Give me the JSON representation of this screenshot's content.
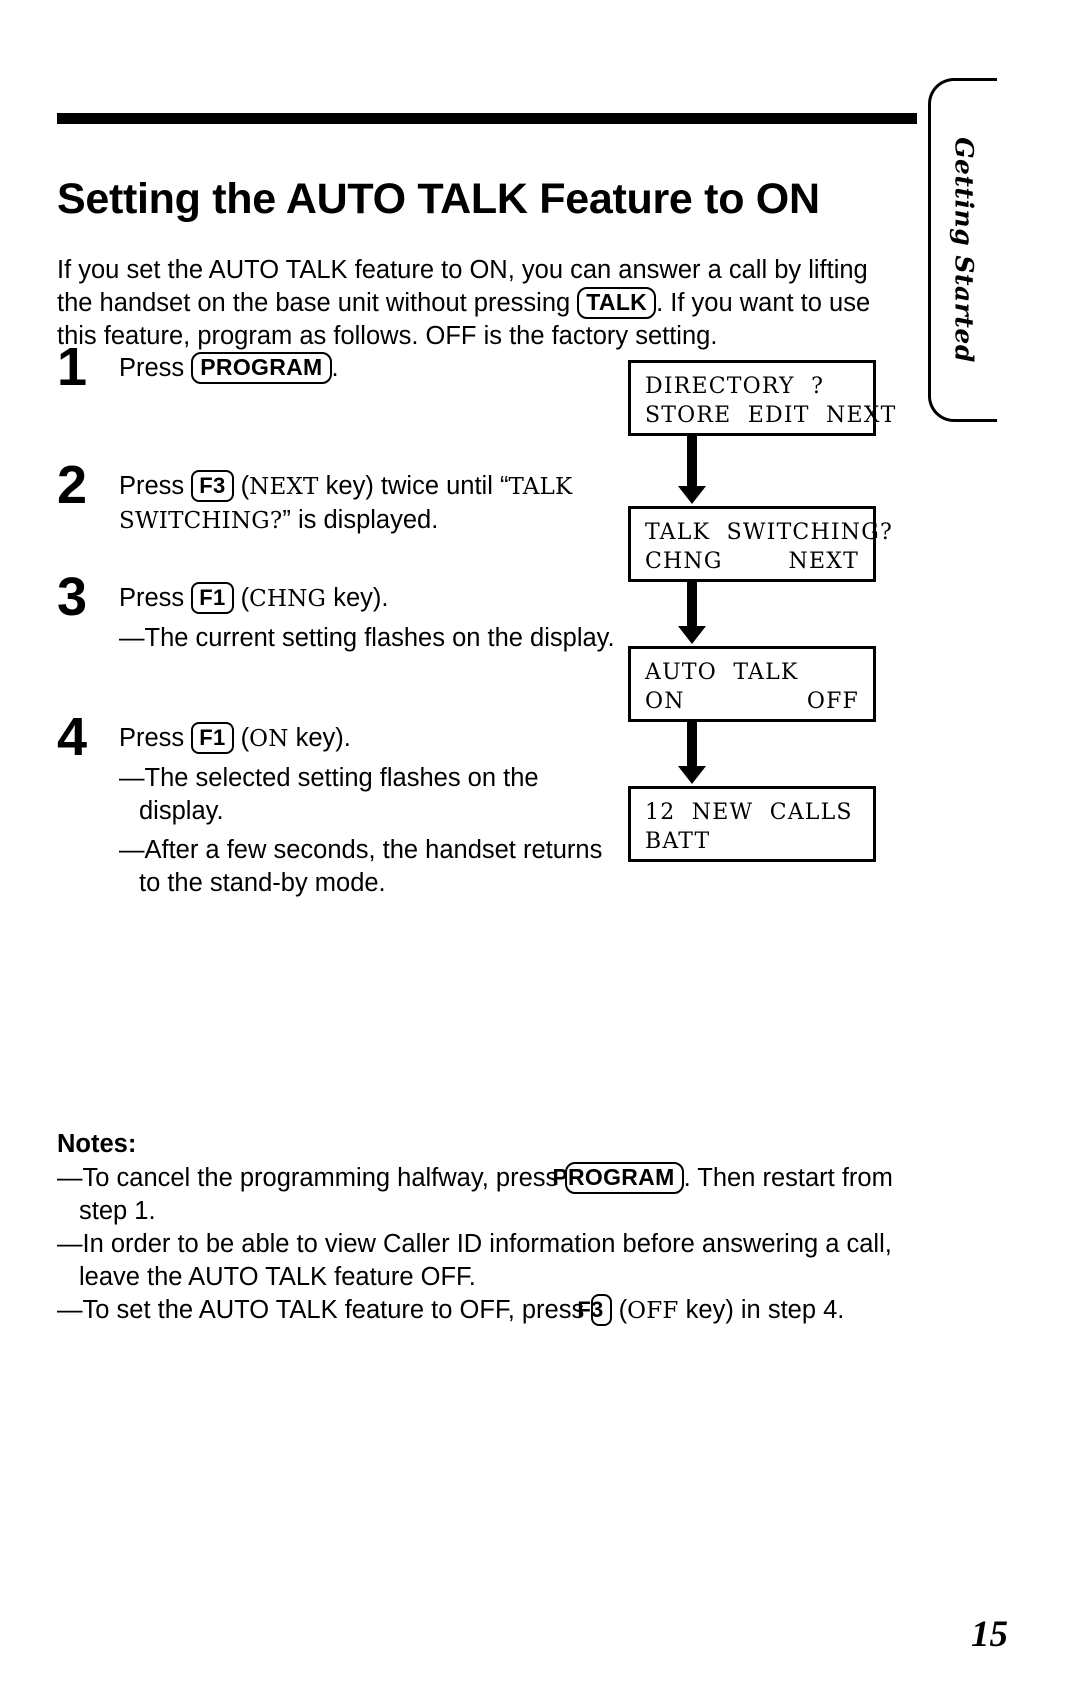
{
  "side_tab": {
    "label": "Getting Started"
  },
  "title": "Setting the AUTO TALK Feature to ON",
  "intro": {
    "part1": "If you set the AUTO TALK feature to ON, you can answer a call by lifting the handset on the base unit without pressing ",
    "key_talk": "TALK",
    "part2": ". If you want to use this feature, program as follows. OFF is the factory setting."
  },
  "steps": [
    {
      "number": "1",
      "pre": "Press ",
      "key": "PROGRAM",
      "post": ".",
      "bullets": []
    },
    {
      "number": "2",
      "pre": "Press ",
      "key": "F3",
      "mid": " (",
      "key_name": "NEXT",
      "post": " key) twice until “",
      "display_ref": "TALK SWITCHING?",
      "tail": "” is displayed.",
      "bullets": []
    },
    {
      "number": "3",
      "pre": "Press ",
      "key": "F1",
      "mid": " (",
      "key_name": "CHNG",
      "post": " key).",
      "bullets": [
        "—The current setting flashes on the display."
      ]
    },
    {
      "number": "4",
      "pre": "Press ",
      "key": "F1",
      "mid": " (",
      "key_name": "ON",
      "post": " key).",
      "bullets": [
        "—The selected setting flashes on the display.",
        "—After a few seconds, the handset returns to the stand-by mode."
      ]
    }
  ],
  "flow": {
    "screens": [
      {
        "line1_left": "DIRECTORY  ?",
        "line1_right": "",
        "line2_left": "STORE  EDIT  NEXT",
        "line2_right": ""
      },
      {
        "line1_left": "TALK  SWITCHING?",
        "line1_right": "",
        "line2_left": "CHNG",
        "line2_right": "NEXT"
      },
      {
        "line1_left": "AUTO  TALK",
        "line1_right": "",
        "line2_left": "ON",
        "line2_right": "OFF"
      },
      {
        "line1_left": "12  NEW  CALLS",
        "line1_right": "",
        "line2_left": "BATT",
        "line2_right": ""
      }
    ]
  },
  "notes": {
    "title": "Notes:",
    "items": [
      {
        "pre": "—To cancel the programming halfway, press ",
        "key": "PROGRAM",
        "post": ". Then restart from step 1."
      },
      {
        "pre": "—In order to be able to view Caller ID information before answering a call, leave the AUTO TALK feature OFF.",
        "key": "",
        "post": ""
      },
      {
        "pre": "—To set the AUTO TALK feature to OFF, press ",
        "key": "F3",
        "key_name": "OFF",
        "post": " key) in step 4.",
        "mid": " ("
      }
    ]
  },
  "page_number": "15"
}
